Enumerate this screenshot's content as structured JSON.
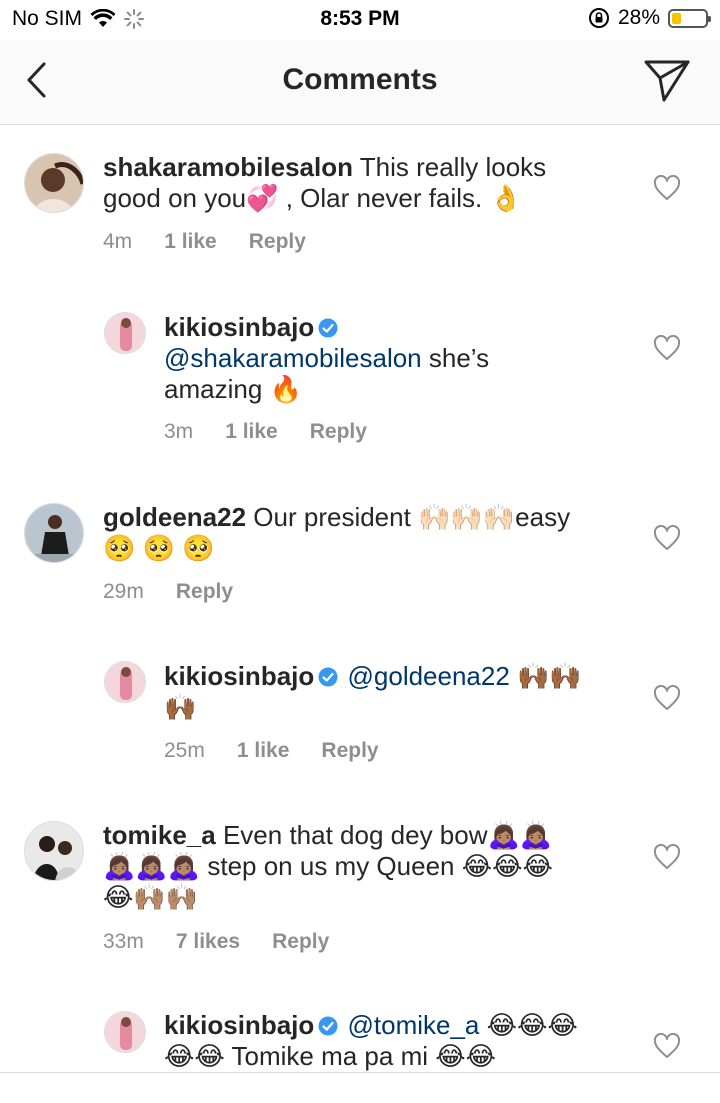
{
  "status_bar": {
    "carrier": "No SIM",
    "time": "8:53 PM",
    "battery": "28%",
    "battery_level": 0.28
  },
  "header": {
    "title": "Comments",
    "back_icon": "chevron-left-icon",
    "send_icon": "paper-plane-icon"
  },
  "comments": [
    {
      "username": "shakaramobilesalon",
      "line1": "This really looks",
      "line2": "good on you💞 , Olar never fails. 👌",
      "time": "4m",
      "likes": "1 like",
      "reply": "Reply"
    },
    {
      "username": "kikiosinbajo",
      "mention": "@shakaramobilesalon",
      "line1_after": "she’s",
      "line2": "amazing 🔥",
      "time": "3m",
      "likes": "1 like",
      "reply": "Reply"
    },
    {
      "username": "goldeena22",
      "line1": "Our president 🙌🏻🙌🏻🙌🏻easy",
      "line2": "🥺 🥺 🥺",
      "time": "29m",
      "reply": "Reply"
    },
    {
      "username": "kikiosinbajo",
      "mention": "@goldeena22",
      "line1_after": "🙌🏾🙌🏾",
      "line2": "🙌🏾",
      "time": "25m",
      "likes": "1 like",
      "reply": "Reply"
    },
    {
      "username": "tomike_a",
      "line1": "Even that dog dey bow🙇🏽‍♀️🙇🏽‍♀️",
      "line2": "🙇🏽‍♀️🙇🏽‍♀️🙇🏽‍♀️ step on us my Queen 😂😂😂",
      "line3": "😂🙌🏽🙌🏽",
      "time": "33m",
      "likes": "7 likes",
      "reply": "Reply"
    },
    {
      "username": "kikiosinbajo",
      "mention": "@tomike_a",
      "line1_after": "😂😂😂",
      "line2": "😂😂 Tomike ma pa mi 😂😂"
    }
  ]
}
